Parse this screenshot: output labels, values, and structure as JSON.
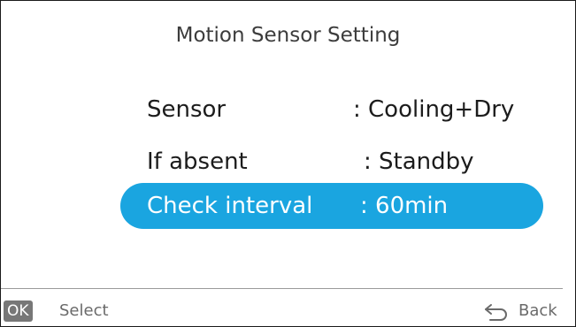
{
  "title": "Motion Sensor Setting",
  "settings": [
    {
      "label": "Sensor",
      "value": ": Cooling+Dry"
    },
    {
      "label": "If absent",
      "value": ": Standby"
    },
    {
      "label": "Check interval",
      "value": ": 60min"
    }
  ],
  "selected_index": 2,
  "footer": {
    "ok_badge": "OK",
    "select_label": "Select",
    "back_label": "Back",
    "back_icon": "return-arrow-icon"
  },
  "colors": {
    "highlight": "#1aa5e0",
    "border": "#1a1a1a",
    "text": "#1c1c1c",
    "footer_text": "#6a6a6a"
  }
}
